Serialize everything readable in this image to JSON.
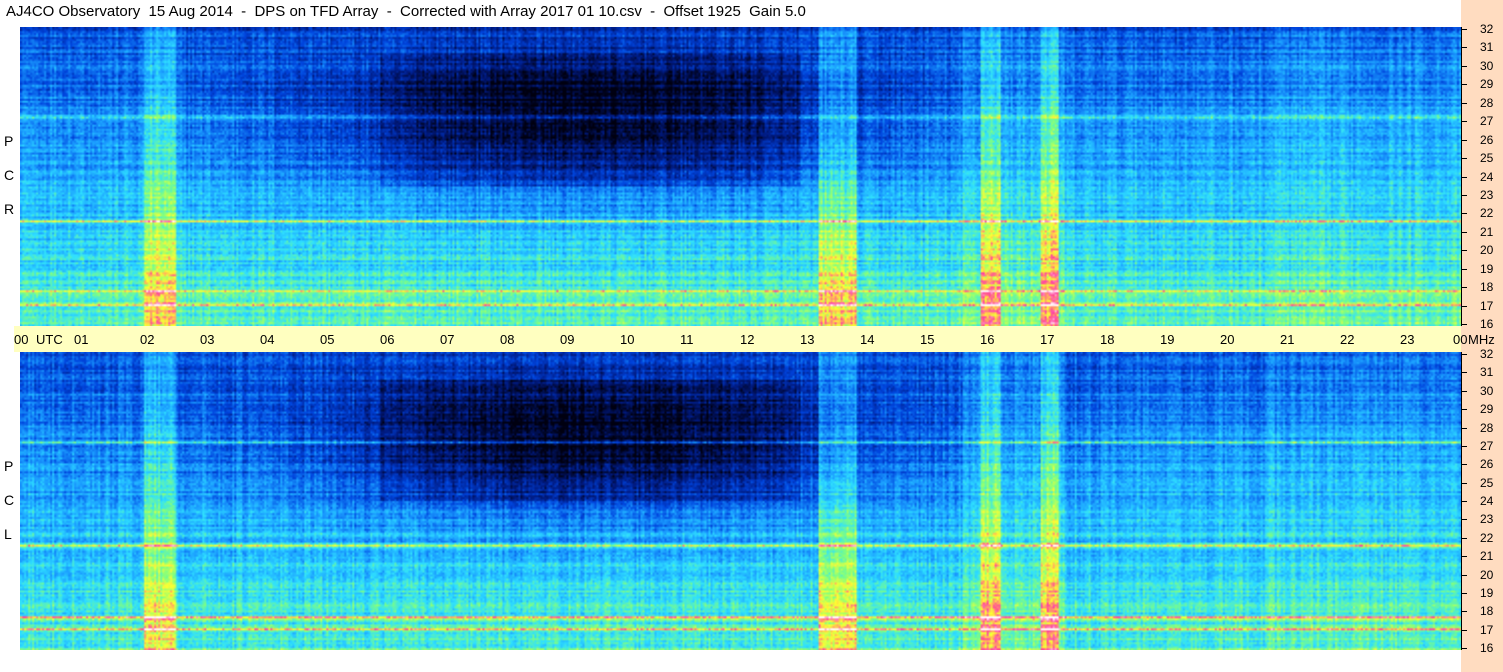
{
  "title": "AJ4CO Observatory  15 Aug 2014  -  DPS on TFD Array  -  Corrected with Array 2017 01 10.csv  -  Offset 1925  Gain 5.0",
  "panels": {
    "top": {
      "polarization": [
        "R",
        "C",
        "P"
      ]
    },
    "bottom": {
      "polarization": [
        "L",
        "C",
        "P"
      ]
    }
  },
  "time_axis": {
    "labels": [
      "00",
      "UTC",
      "01",
      "02",
      "03",
      "04",
      "05",
      "06",
      "07",
      "08",
      "09",
      "10",
      "11",
      "12",
      "13",
      "14",
      "15",
      "16",
      "17",
      "18",
      "19",
      "20",
      "21",
      "22",
      "23",
      "00",
      "MHz"
    ]
  },
  "freq_axis": {
    "labels": [
      "32",
      "31",
      "30",
      "29",
      "28",
      "27",
      "26",
      "25",
      "24",
      "23",
      "22",
      "21",
      "20",
      "19",
      "18",
      "17",
      "16"
    ]
  },
  "chart_data": [
    {
      "type": "heatmap",
      "title": "AJ4CO Observatory  15 Aug 2014  -  DPS on TFD Array  -  Corrected with Array 2017 01 10.csv  -  Offset 1925  Gain 5.0",
      "panel": "RCP",
      "xlabel": "UTC",
      "ylabel": "MHz",
      "xlim": [
        0,
        24
      ],
      "ylim": [
        16,
        32
      ],
      "colormap": [
        "#000010",
        "#001a80",
        "#0044dd",
        "#1a9aff",
        "#2fe0ff",
        "#7fff80",
        "#ffff30",
        "#ff40a0",
        "#ffffff"
      ],
      "features": {
        "vertical_bands_utc": [
          [
            2.05,
            2.6
          ],
          [
            13.3,
            13.95
          ],
          [
            16.0,
            16.35
          ],
          [
            17.0,
            17.3
          ]
        ],
        "broadband_utc": [
          [
            15.7,
            17.4
          ]
        ],
        "horizontal_lines_mhz": [
          17.1,
          17.8,
          21.6,
          27.2
        ],
        "dark_region_utc": [
          6.0,
          13.0
        ],
        "dark_region_mhz": [
          23.5,
          30.5
        ]
      }
    },
    {
      "type": "heatmap",
      "panel": "LCP",
      "xlabel": "UTC",
      "ylabel": "MHz",
      "xlim": [
        0,
        24
      ],
      "ylim": [
        16,
        32
      ],
      "colormap": [
        "#000010",
        "#001a80",
        "#0044dd",
        "#1a9aff",
        "#2fe0ff",
        "#7fff80",
        "#ffff30",
        "#ff40a0",
        "#ffffff"
      ],
      "features": {
        "vertical_bands_utc": [
          [
            2.05,
            2.6
          ],
          [
            13.3,
            13.95
          ],
          [
            16.0,
            16.35
          ],
          [
            17.0,
            17.3
          ]
        ],
        "broadband_utc": [
          [
            15.7,
            17.4
          ]
        ],
        "horizontal_lines_mhz": [
          17.1,
          17.7,
          21.6,
          27.2
        ],
        "dark_region_utc": [
          6.0,
          13.0
        ],
        "dark_region_mhz": [
          24.0,
          30.5
        ]
      }
    }
  ]
}
